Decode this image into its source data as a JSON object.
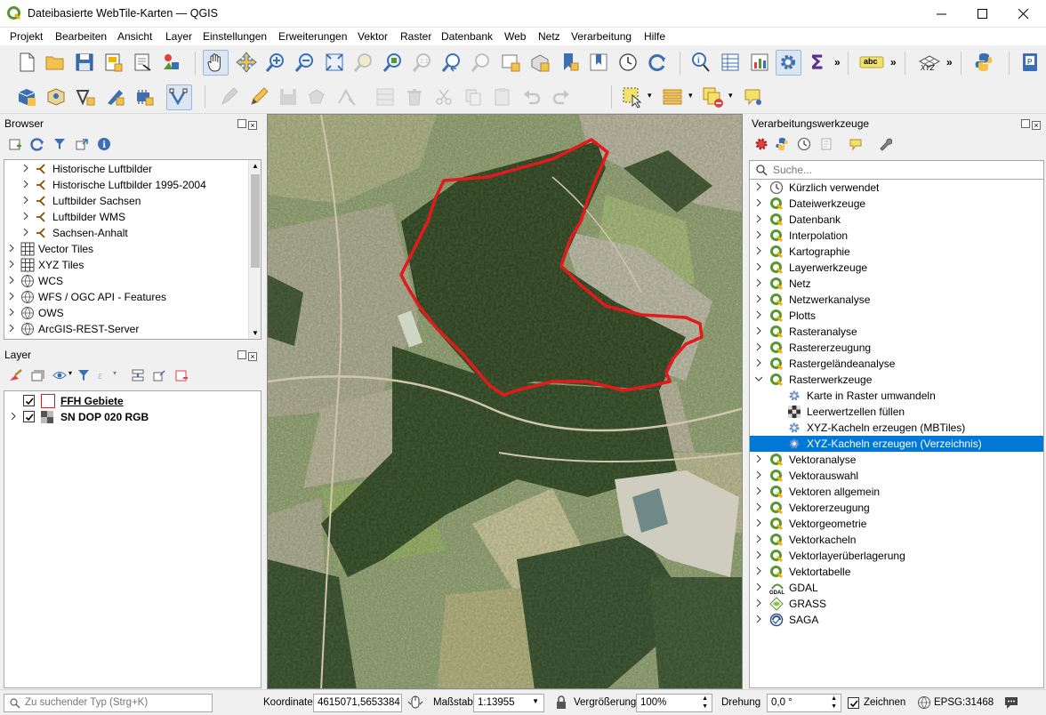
{
  "window": {
    "title": "Dateibasierte WebTile-Karten — QGIS",
    "controls": [
      "minimize",
      "maximize",
      "close"
    ]
  },
  "menu": [
    {
      "label": "Projekt"
    },
    {
      "label": "Bearbeiten"
    },
    {
      "label": "Ansicht"
    },
    {
      "label": "Layer"
    },
    {
      "label": "Einstellungen"
    },
    {
      "label": "Erweiterungen"
    },
    {
      "label": "Vektor"
    },
    {
      "label": "Raster"
    },
    {
      "label": "Datenbank"
    },
    {
      "label": "Web"
    },
    {
      "label": "Netz"
    },
    {
      "label": "Verarbeitung"
    },
    {
      "label": "Hilfe"
    }
  ],
  "toolbar": {
    "overflow_1": "»",
    "overflow_2": "»",
    "overflow_3": "»",
    "label_tool_text": "abc",
    "xyz_text": "XYZ"
  },
  "browser": {
    "title": "Browser",
    "items": [
      {
        "label": "Historische Luftbilder",
        "icon": "wms-icon"
      },
      {
        "label": "Historische Luftbilder 1995-2004",
        "icon": "wms-icon"
      },
      {
        "label": "Luftbilder Sachsen",
        "icon": "wms-icon"
      },
      {
        "label": "Luftbilder WMS",
        "icon": "wms-icon"
      },
      {
        "label": "Sachsen-Anhalt",
        "icon": "wms-icon"
      },
      {
        "label": "Vector Tiles",
        "icon": "grid-icon"
      },
      {
        "label": "XYZ Tiles",
        "icon": "grid-icon"
      },
      {
        "label": "WCS",
        "icon": "globe-icon"
      },
      {
        "label": "WFS / OGC API - Features",
        "icon": "globe-icon"
      },
      {
        "label": "OWS",
        "icon": "globe-icon"
      },
      {
        "label": "ArcGIS-REST-Server",
        "icon": "globe-icon"
      }
    ]
  },
  "layers": {
    "title": "Layer",
    "items": [
      {
        "label": "FFH Gebiete",
        "checked": true,
        "color": "#e31a1c"
      },
      {
        "label": "SN DOP 020 RGB",
        "checked": true
      }
    ]
  },
  "processing": {
    "title": "Verarbeitungswerkzeuge",
    "search_placeholder": "Suche...",
    "items": [
      {
        "label": "Kürzlich verwendet",
        "icon": "clock-icon"
      },
      {
        "label": "Dateiwerkzeuge",
        "icon": "qgis-icon"
      },
      {
        "label": "Datenbank",
        "icon": "qgis-icon"
      },
      {
        "label": "Interpolation",
        "icon": "qgis-icon"
      },
      {
        "label": "Kartographie",
        "icon": "qgis-icon"
      },
      {
        "label": "Layerwerkzeuge",
        "icon": "qgis-icon"
      },
      {
        "label": "Netz",
        "icon": "qgis-icon"
      },
      {
        "label": "Netzwerkanalyse",
        "icon": "qgis-icon"
      },
      {
        "label": "Plotts",
        "icon": "qgis-icon"
      },
      {
        "label": "Rasteranalyse",
        "icon": "qgis-icon"
      },
      {
        "label": "Rastererzeugung",
        "icon": "qgis-icon"
      },
      {
        "label": "Rastergeländeanalyse",
        "icon": "qgis-icon"
      },
      {
        "label": "Rasterwerkzeuge",
        "icon": "qgis-icon",
        "expanded": true
      },
      {
        "label": "Karte in Raster umwandeln",
        "icon": "gear-icon",
        "child": true
      },
      {
        "label": "Leerwertzellen füllen",
        "icon": "raster-icon",
        "child": true
      },
      {
        "label": "XYZ-Kacheln erzeugen (MBTiles)",
        "icon": "gear-icon",
        "child": true
      },
      {
        "label": "XYZ-Kacheln erzeugen (Verzeichnis)",
        "icon": "gear-icon",
        "child": true,
        "selected": true
      },
      {
        "label": "Vektoranalyse",
        "icon": "qgis-icon"
      },
      {
        "label": "Vektorauswahl",
        "icon": "qgis-icon"
      },
      {
        "label": "Vektoren allgemein",
        "icon": "qgis-icon"
      },
      {
        "label": "Vektorerzeugung",
        "icon": "qgis-icon"
      },
      {
        "label": "Vektorgeometrie",
        "icon": "qgis-icon"
      },
      {
        "label": "Vektorkacheln",
        "icon": "qgis-icon"
      },
      {
        "label": "Vektorlayerüberlagerung",
        "icon": "qgis-icon"
      },
      {
        "label": "Vektortabelle",
        "icon": "qgis-icon"
      },
      {
        "label": "GDAL",
        "icon": "gdal-icon"
      },
      {
        "label": "GRASS",
        "icon": "grass-icon"
      },
      {
        "label": "SAGA",
        "icon": "saga-icon"
      }
    ]
  },
  "statusbar": {
    "locator_placeholder": "Zu suchender Typ (Strg+K)",
    "coordinate_label": "Koordinate",
    "coordinate_value": "4615071,5653384",
    "scale_label": "Maßstab",
    "scale_value": "1:13955",
    "magnifier_label": "Vergrößerung",
    "magnifier_value": "100%",
    "rotation_label": "Drehung",
    "rotation_value": "0,0 °",
    "render_label": "Zeichnen",
    "render_checked": true,
    "crs": "EPSG:31468"
  },
  "colors": {
    "selection": "#0078d7",
    "ffh_outline": "#e31a1c",
    "qgis_green": "#589632"
  }
}
